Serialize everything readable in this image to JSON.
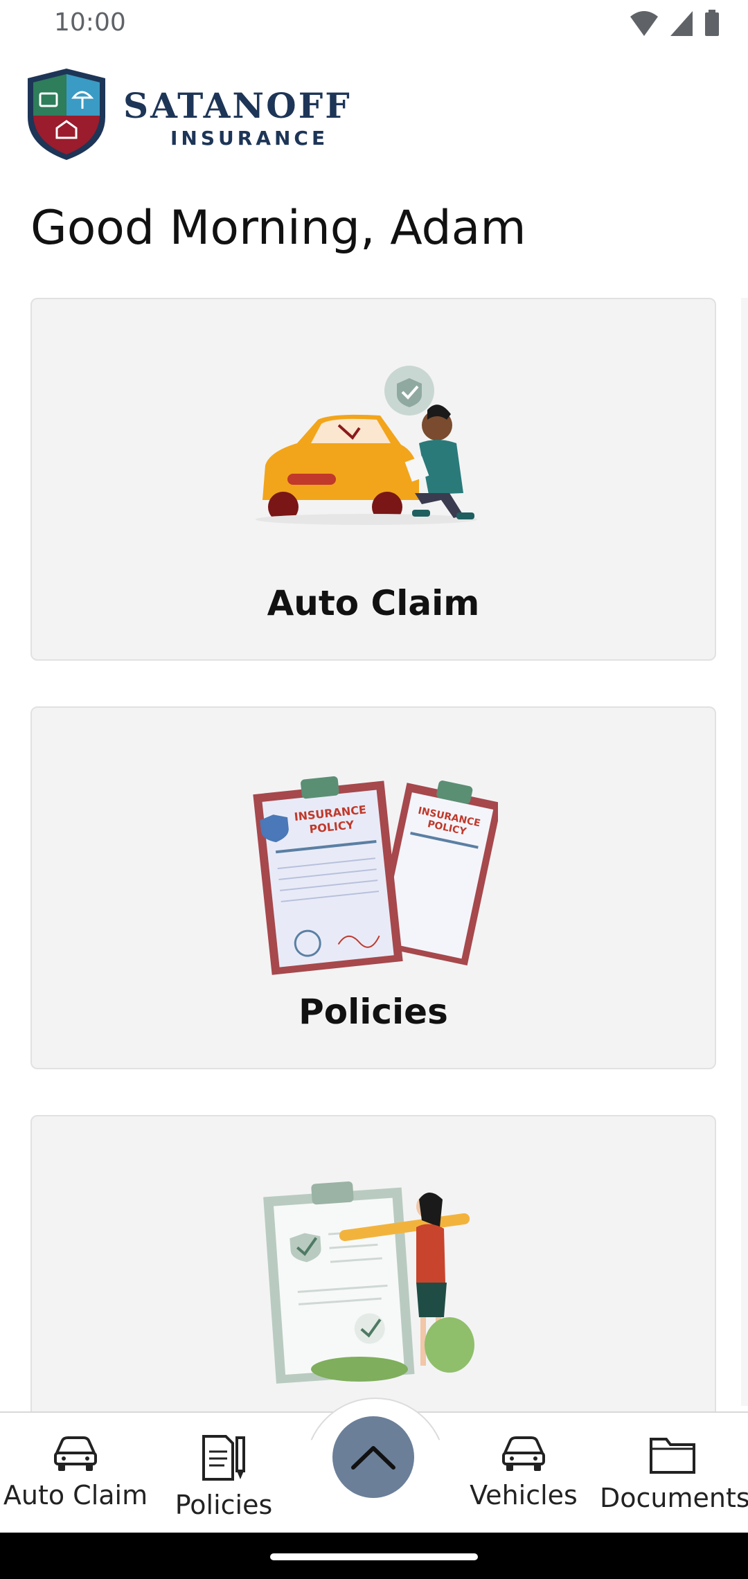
{
  "status_bar": {
    "time": "10:00"
  },
  "header": {
    "brand_name": "SATANOFF",
    "brand_sub": "INSURANCE"
  },
  "greeting": "Good Morning, Adam",
  "cards": [
    {
      "label": "Auto Claim"
    },
    {
      "label": "Policies"
    },
    {
      "label": ""
    }
  ],
  "illustration_text": {
    "policy_line1": "INSURANCE",
    "policy_line2": "POLICY"
  },
  "bottom_nav": {
    "items": [
      {
        "label": "Auto Claim",
        "icon": "car-icon"
      },
      {
        "label": "Policies",
        "icon": "document-pen-icon"
      },
      {
        "label": "Vehicles",
        "icon": "car-icon"
      },
      {
        "label": "Documents",
        "icon": "folder-icon"
      }
    ],
    "fab_icon": "chevron-up-icon"
  },
  "colors": {
    "brand": "#1d3557",
    "fab": "#6b7f99",
    "card_bg": "#f3f3f4"
  }
}
